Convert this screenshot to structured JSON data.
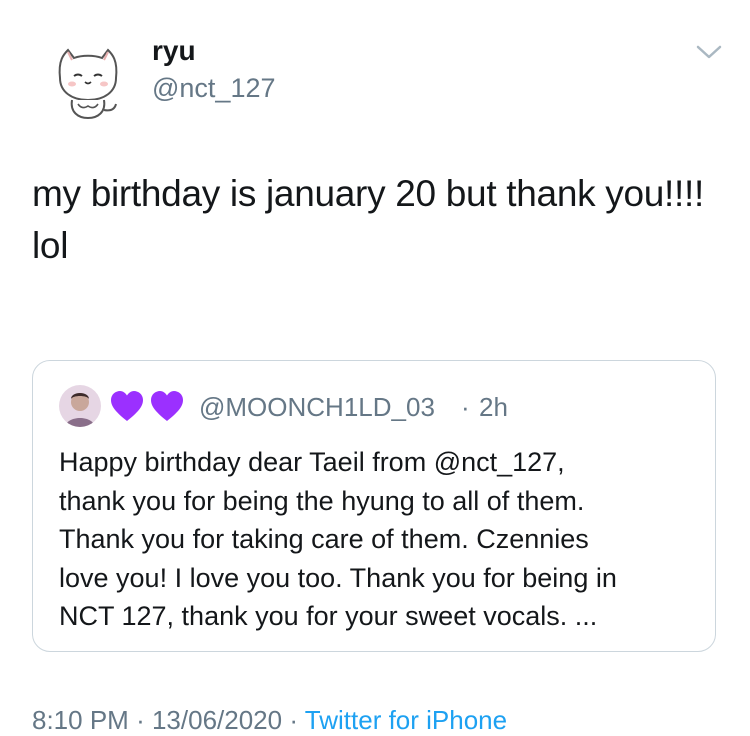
{
  "author": {
    "display_name": "ryu",
    "handle": "@nct_127",
    "avatar_icon": "white-cat-avatar-icon"
  },
  "menu": {
    "icon": "chevron-down-icon"
  },
  "tweet": {
    "text": "my birthday is january 20 but thank you!!!! lol"
  },
  "quoted_tweet": {
    "hearts": [
      "purple-heart",
      "purple-heart"
    ],
    "handle": "@MOONCH1LD_03",
    "separator": "·",
    "time": "2h",
    "text": "Happy birthday dear Taeil from @nct_127,\nthank you for being the hyung to all of them.\nThank you for taking care of them. Czennies\nlove you! I love you too. Thank you for being in\nNCT  127, thank you for your sweet vocals. ..."
  },
  "footer": {
    "time": "8:10 PM",
    "separator": "·",
    "date": "13/06/2020",
    "source": "Twitter for iPhone"
  },
  "colors": {
    "text": "#14171a",
    "secondary": "#657786",
    "border": "#ccd6dd",
    "accent": "#1da1f2",
    "heart": "#9b30ff"
  }
}
